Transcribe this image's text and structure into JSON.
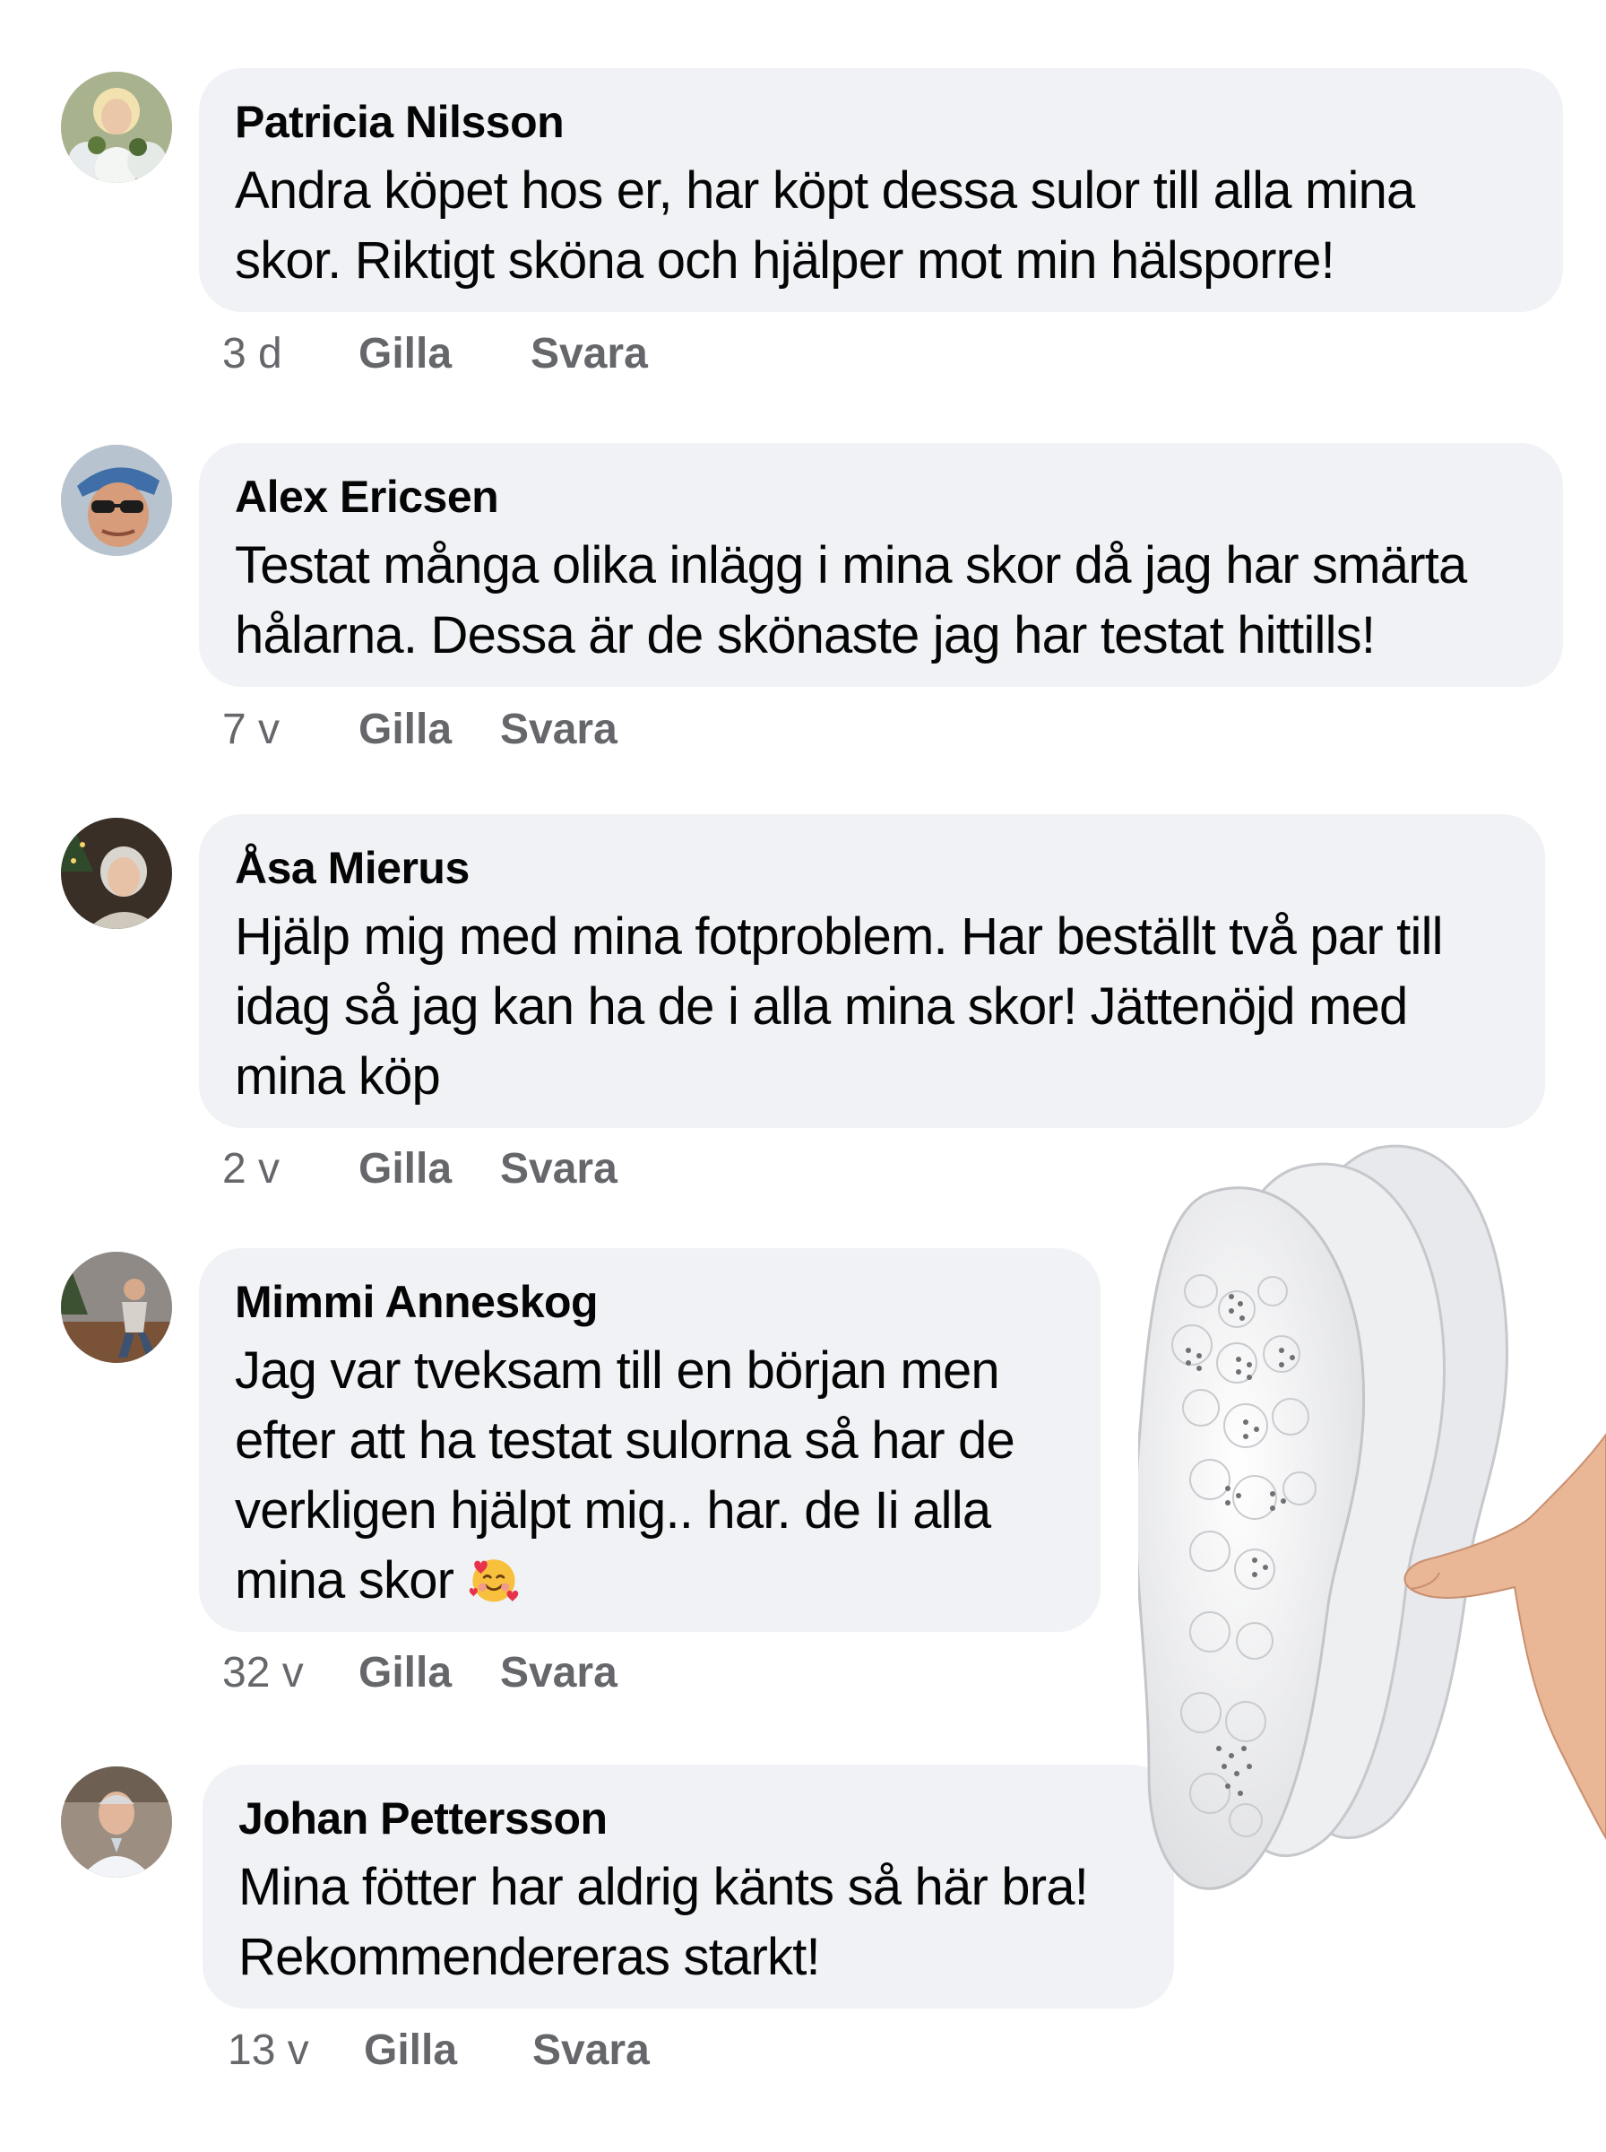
{
  "comments": [
    {
      "name": "Patricia Nilsson",
      "text": "Andra köpet hos er, har köpt dessa sulor till alla mina\nskor. Riktigt sköna och hjälper mot min hälsporre!",
      "time": "3 d",
      "like_label": "Gilla",
      "reply_label": "Svara",
      "avatar_icon": "woman-with-flowers-avatar"
    },
    {
      "name": "Alex Ericsen",
      "text": "Testat många olika inlägg i mina skor då jag har smärta\nhålarna. Dessa är de skönaste jag har testat hittills!",
      "time": "7 v",
      "like_label": "Gilla",
      "reply_label": "Svara",
      "avatar_icon": "man-with-cap-avatar"
    },
    {
      "name": "Åsa Mierus",
      "text": "Hjälp mig med mina fotproblem. Har beställt två par till\nidag så jag kan ha de  i alla mina skor! Jättenöjd med\nmina köp",
      "time": "2 v",
      "like_label": "Gilla",
      "reply_label": "Svara",
      "avatar_icon": "woman-christmas-avatar"
    },
    {
      "name": "Mimmi Anneskog",
      "text": "Jag var tveksam till en början men\nefter att ha testat sulorna så har de\nverkligen hjälpt mig.. har. de Ii alla\nmina skor ",
      "emoji": "smiling-face-with-hearts",
      "time": "32 v",
      "like_label": "Gilla",
      "reply_label": "Svara",
      "avatar_icon": "woman-sitting-avatar"
    },
    {
      "name": "Johan Pettersson",
      "text": "Mina fötter har aldrig känts så här bra!\nRekommendereras starkt!",
      "time": "13 v",
      "like_label": "Gilla",
      "reply_label": "Svara",
      "avatar_icon": "man-white-shirt-avatar"
    }
  ],
  "product_image": "white-insoles-held-in-hand",
  "colors": {
    "bubble": "#f0f2f5",
    "meta": "#65676b",
    "text": "#050505"
  }
}
